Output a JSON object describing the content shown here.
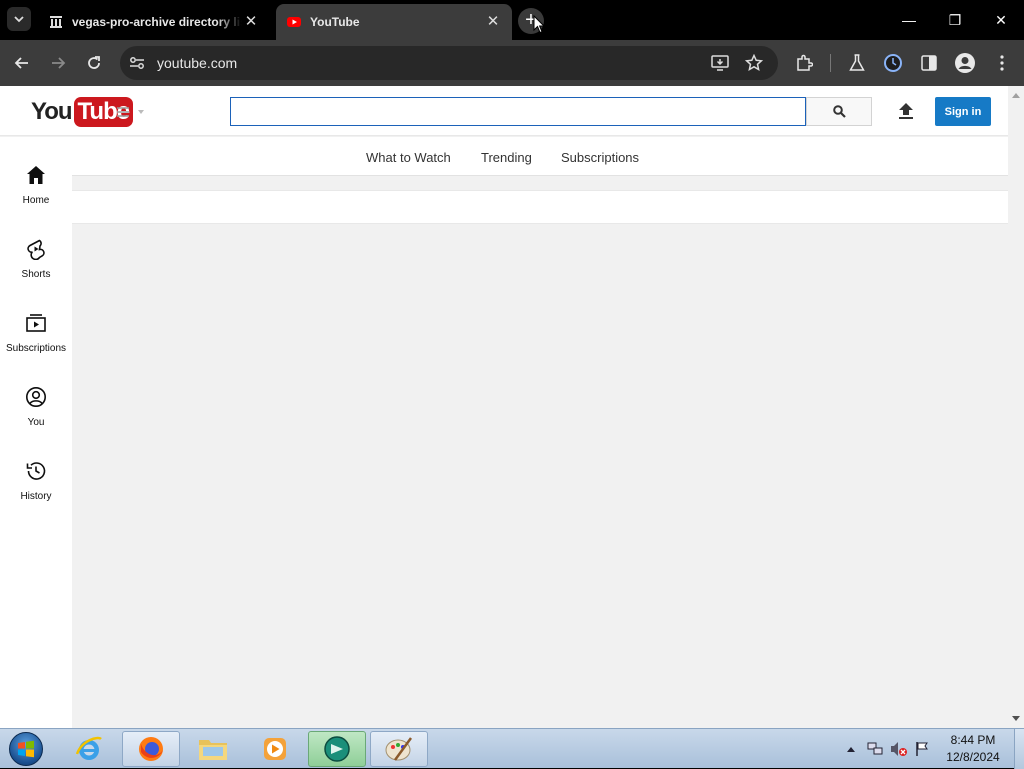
{
  "browser": {
    "tabs": [
      {
        "title": "vegas-pro-archive directory listing",
        "favicon": "archive-icon",
        "close": "✕"
      },
      {
        "title": "YouTube",
        "favicon": "youtube-icon",
        "close": "✕"
      }
    ],
    "new_tab": "+",
    "window_controls": {
      "minimize": "—",
      "restore": "❐",
      "close": "✕"
    },
    "address": "youtube.com"
  },
  "youtube": {
    "logo": {
      "you": "You",
      "tube": "Tube"
    },
    "search": {
      "value": "",
      "placeholder": ""
    },
    "sign_in": "Sign in",
    "top_nav": [
      "What to Watch",
      "Trending",
      "Subscriptions"
    ],
    "mini_guide": [
      {
        "label": "Home",
        "icon": "home-icon"
      },
      {
        "label": "Shorts",
        "icon": "shorts-icon"
      },
      {
        "label": "Subscriptions",
        "icon": "subscriptions-icon"
      },
      {
        "label": "You",
        "icon": "you-icon"
      },
      {
        "label": "History",
        "icon": "history-icon"
      }
    ]
  },
  "taskbar": {
    "clock_time": "8:44 PM",
    "clock_date": "12/8/2024",
    "apps": [
      "internet-explorer",
      "firefox",
      "file-explorer",
      "media-player",
      "active-app",
      "paint"
    ]
  },
  "colors": {
    "accent": "#167ac6",
    "youtube_red": "#cc181e",
    "chrome_dark": "#3c3c3c"
  }
}
